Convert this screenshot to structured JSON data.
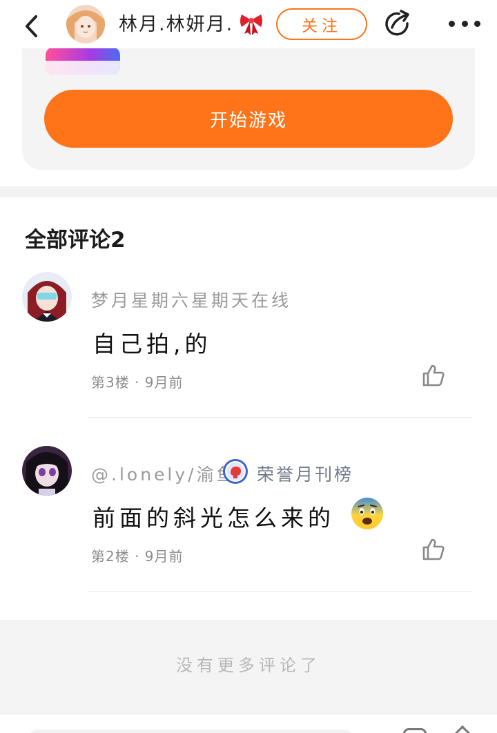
{
  "header": {
    "username": "林月.林妍月.",
    "follow_label": "关注"
  },
  "game_card": {
    "partial_text": "…",
    "start_button_label": "开始游戏"
  },
  "comments_section": {
    "title": "全部评论2",
    "comments": [
      {
        "username": "梦月星期六星期天在线",
        "text": "自己拍,的",
        "meta": "第3楼 · 9月前"
      },
      {
        "username": "@.lonely/渝鱼.",
        "badge_label": "荣誉月刊榜",
        "text": "前面的斜光怎么来的",
        "meta": "第2楼 · 9月前"
      }
    ]
  },
  "footer": {
    "no_more_text": "没有更多评论了"
  },
  "colors": {
    "accent": "#ff7418",
    "background": "#ffffff",
    "band": "#f4f4f4"
  },
  "icons": [
    "back-arrow-icon",
    "share-icon",
    "more-icon",
    "thumbs-up-icon",
    "bow-icon",
    "badge-icon",
    "anxious-face-emoji"
  ]
}
